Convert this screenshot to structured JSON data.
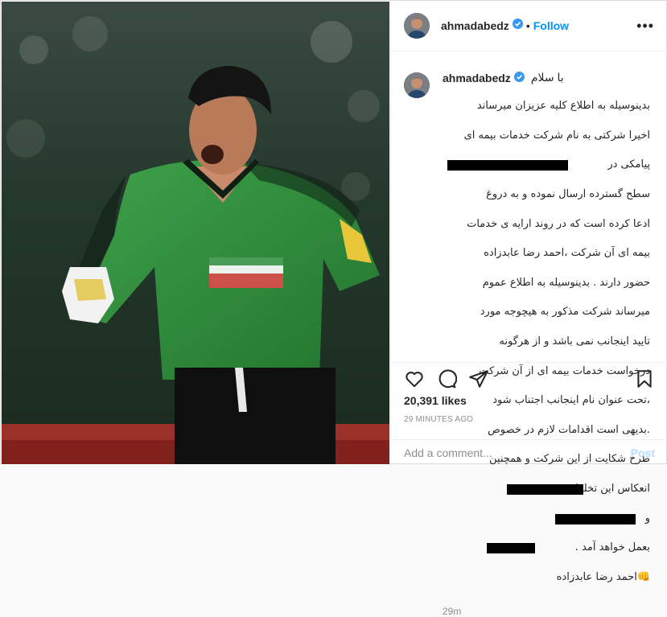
{
  "header": {
    "username": "ahmadabedz",
    "separator": "•",
    "follow_label": "Follow",
    "more_label": "•••"
  },
  "caption": {
    "username": "ahmadabedz",
    "greeting": "با سلام",
    "lines": [
      "بدینوسیله به اطلاع کلیه عزیزان میرساند",
      "اخیرا شرکتی به نام شرکت خدمات بیمه ای",
      "پیامکی در",
      "سطح گسترده ارسال نموده و به دروغ",
      "ادعا کرده است که در روند ارایه ی خدمات",
      "بیمه ای آن شرکت ،احمد رضا عابدزاده",
      "حضور دارند . بدینوسیله به اطلاع عموم",
      "میرساند شرکت مذکور به هیچوجه مورد",
      "تایید اینجانب نمی باشد و از هرگونه",
      "درخواست خدمات بیمه ای از آن شرکت",
      "،تحت عنوان نام اینجانب اجتناب شود",
      ".بدیهی است اقدامات لازم در خصوص",
      "طرح شکایت از این شرکت و همچنین",
      "انعکاس این تخلفات به",
      "و",
      ".",
      "بعمل خواهد آمد",
      "احمد رضا عابدزاده"
    ],
    "signoff_emoji": "👊",
    "time": "29m"
  },
  "actions": {
    "like_icon": "heart-icon",
    "comment_icon": "comment-icon",
    "share_icon": "share-icon",
    "save_icon": "bookmark-icon"
  },
  "likes": "20,391 likes",
  "timestamp": "29 MINUTES AGO",
  "comment_box": {
    "placeholder": "Add a comment...",
    "post_label": "Post"
  },
  "colors": {
    "accent": "#0095f6",
    "post_disabled": "#b2dffc",
    "muted": "#8e8e8e",
    "verified": "#3897f0",
    "jersey": "#2f8a3a"
  }
}
